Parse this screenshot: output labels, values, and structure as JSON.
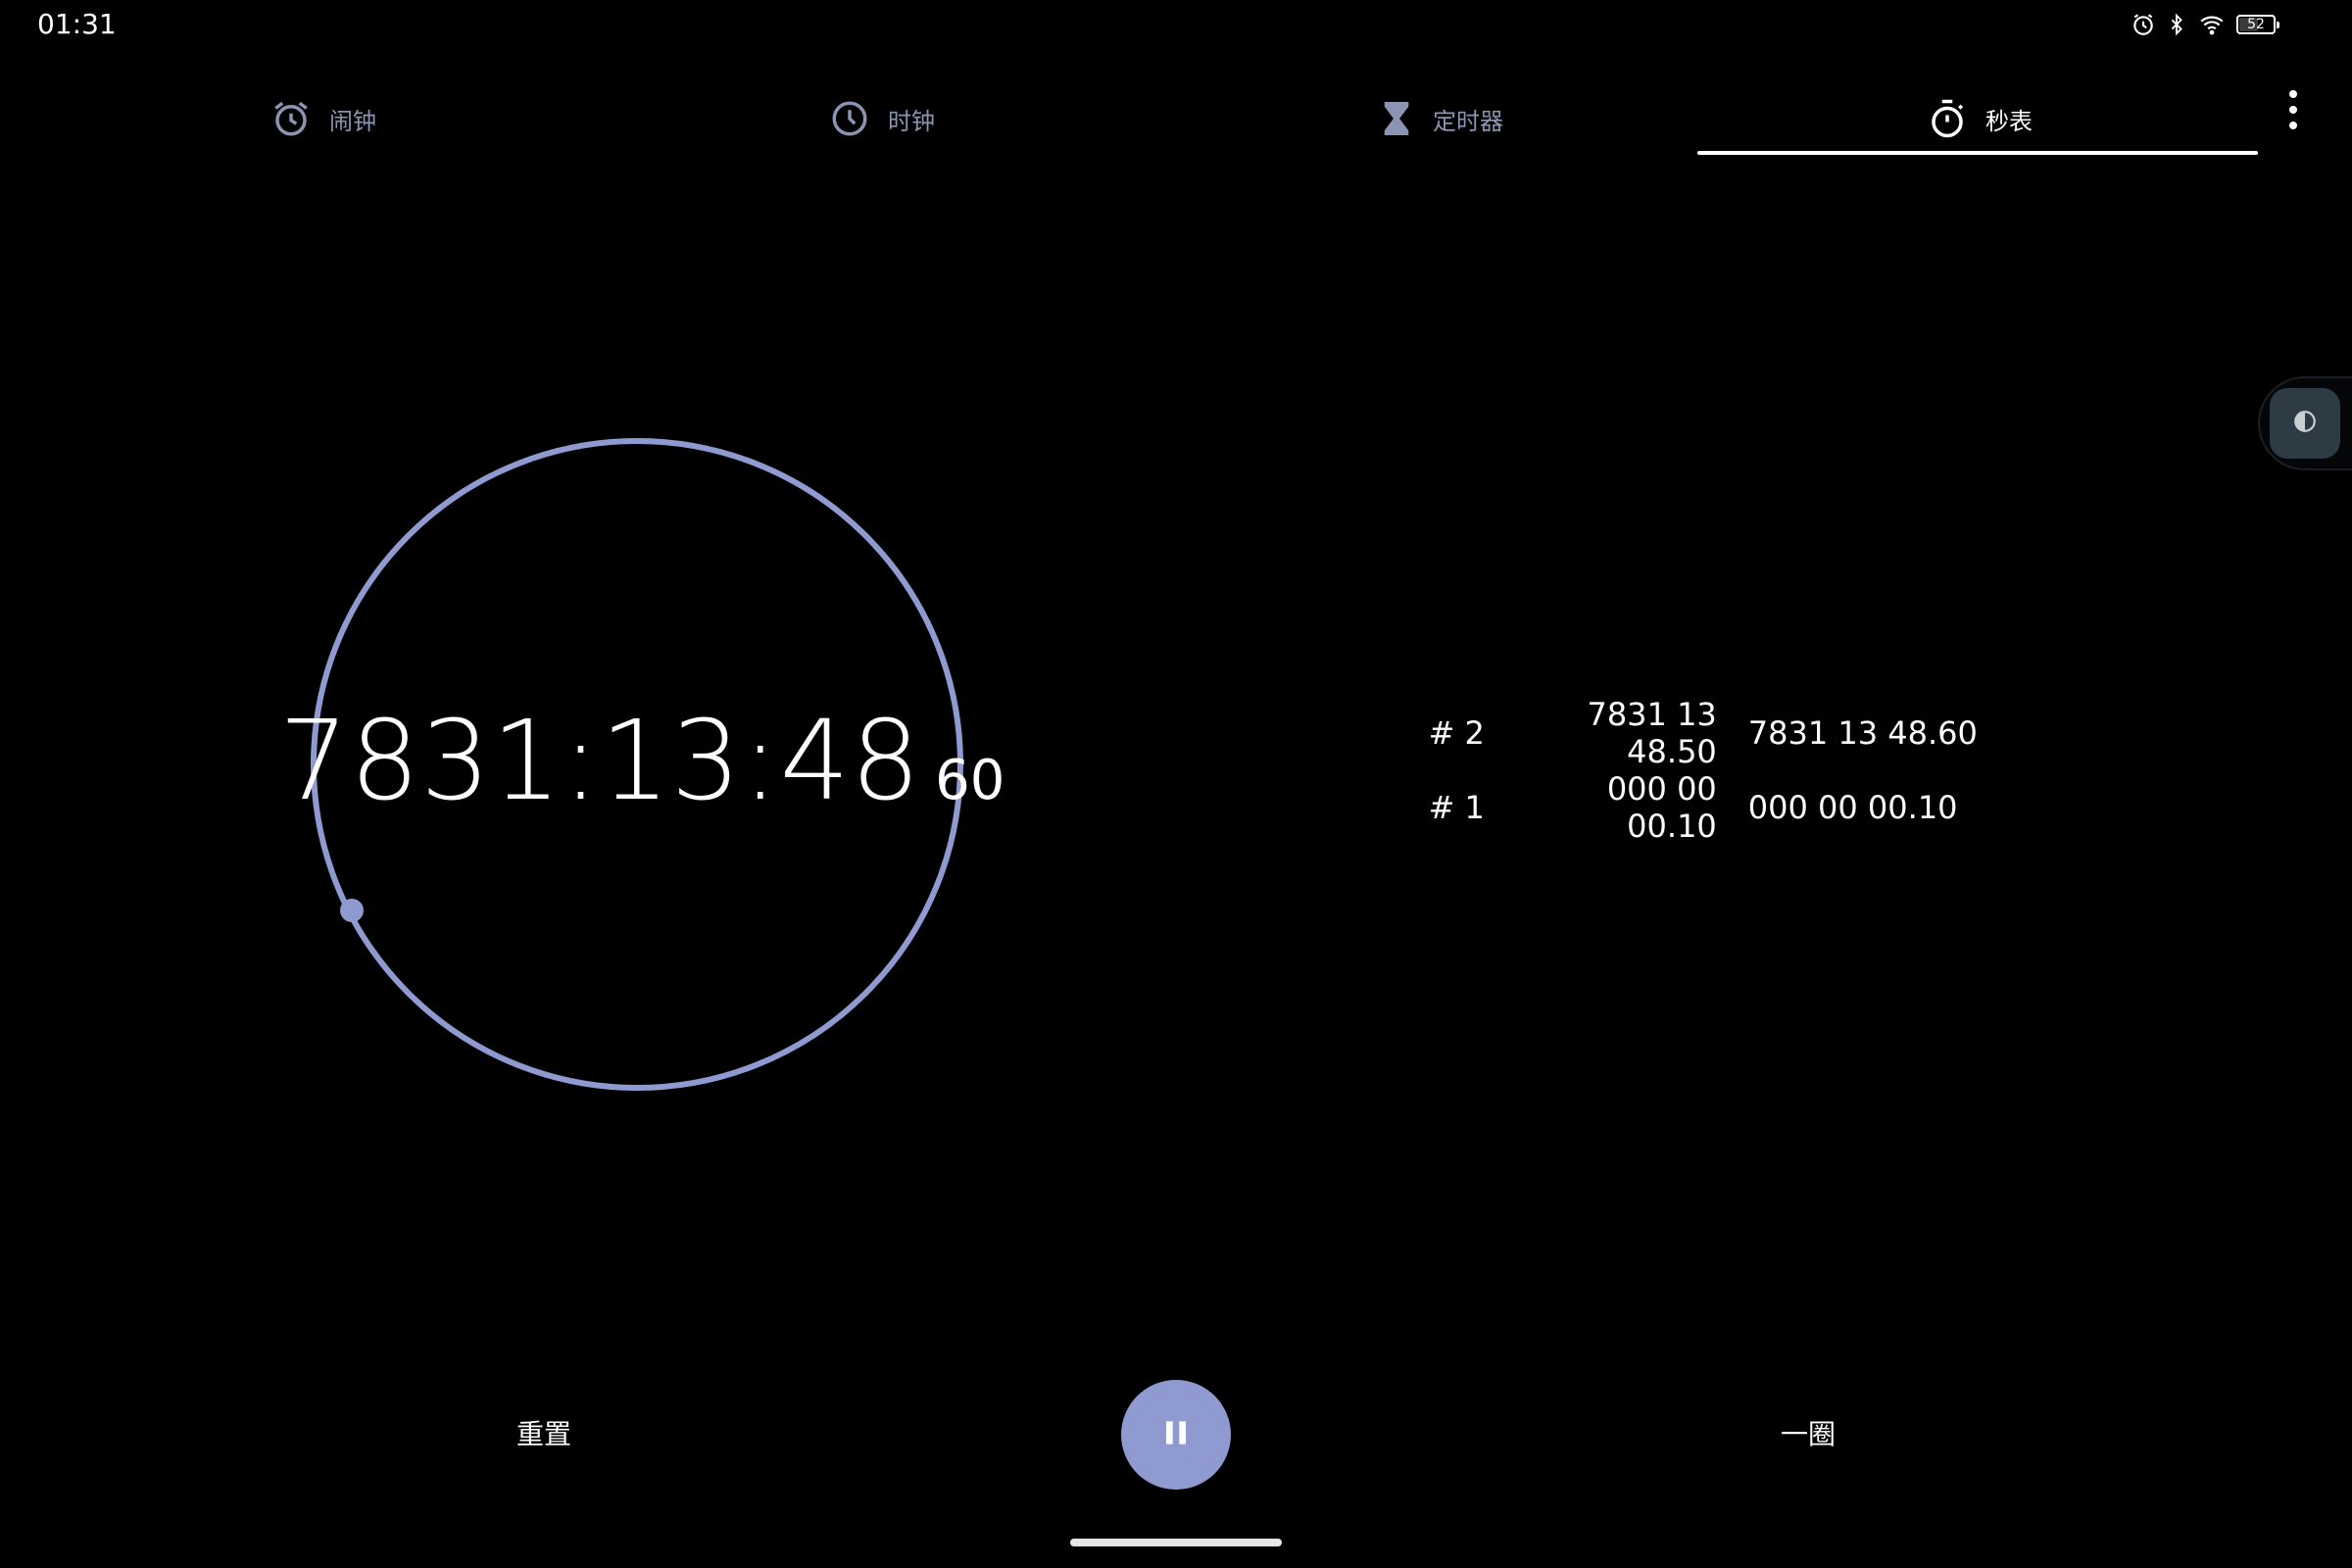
{
  "status_bar": {
    "time": "01:31",
    "icons": [
      "alarm-icon",
      "bluetooth-icon",
      "wifi-icon",
      "battery-icon"
    ],
    "battery_level": "52",
    "battery_fraction": 0.52
  },
  "tabs": [
    {
      "label": "闹钟",
      "icon": "alarm-clock-icon",
      "active": false
    },
    {
      "label": "时钟",
      "icon": "clock-icon",
      "active": false
    },
    {
      "label": "定时器",
      "icon": "hourglass-icon",
      "active": false
    },
    {
      "label": "秒表",
      "icon": "stopwatch-icon",
      "active": true
    }
  ],
  "stopwatch": {
    "time_main": "7831:13:48",
    "time_hundredths": "60",
    "dial_color": "#8e9ad0"
  },
  "laps": [
    {
      "number": "# 2",
      "split": "7831 13 48.50",
      "total": "7831 13 48.60"
    },
    {
      "number": "# 1",
      "split": "000 00 00.10",
      "total": "000 00 00.10"
    }
  ],
  "controls": {
    "reset_label": "重置",
    "lap_label": "一圈",
    "pause_icon": "pause-icon"
  },
  "colors": {
    "accent": "#8e9ad0",
    "inactive_tab": "#8c94b3",
    "background": "#000000"
  }
}
